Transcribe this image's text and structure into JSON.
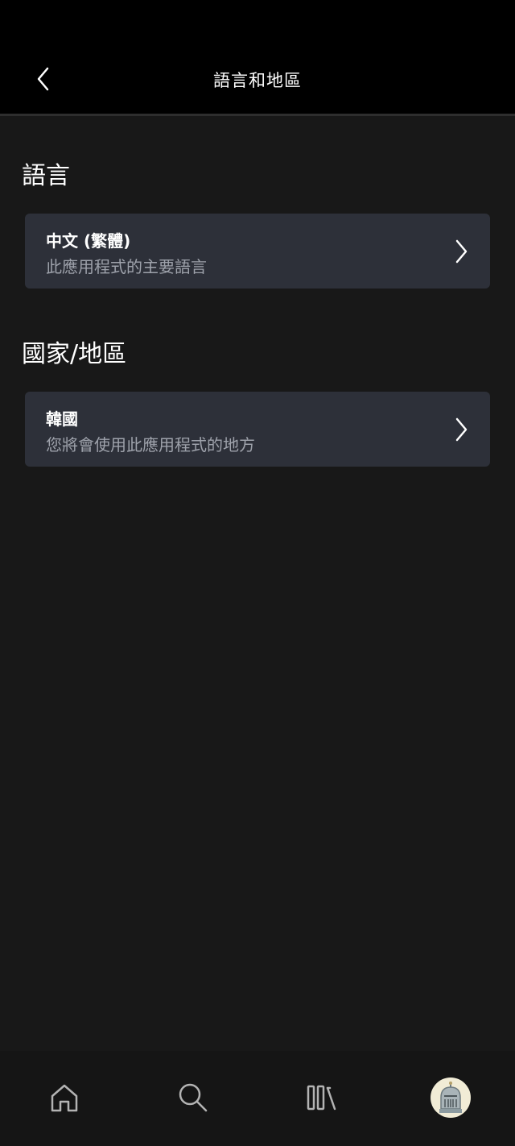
{
  "header": {
    "title": "語言和地區",
    "back_icon": "chevron-left-icon"
  },
  "sections": [
    {
      "title": "語言",
      "card": {
        "title": "中文 (繁體)",
        "subtitle": "此應用程式的主要語言"
      }
    },
    {
      "title": "國家/地區",
      "card": {
        "title": "韓國",
        "subtitle": "您將會使用此應用程式的地方"
      }
    }
  ],
  "bottom_nav": {
    "items": [
      {
        "icon": "home-icon"
      },
      {
        "icon": "search-icon"
      },
      {
        "icon": "library-icon"
      },
      {
        "icon": "profile-avatar"
      }
    ]
  },
  "colors": {
    "background": "#181818",
    "header_background": "#000000",
    "card_background": "#2d3039",
    "subtitle_text": "#9ea2ab"
  }
}
